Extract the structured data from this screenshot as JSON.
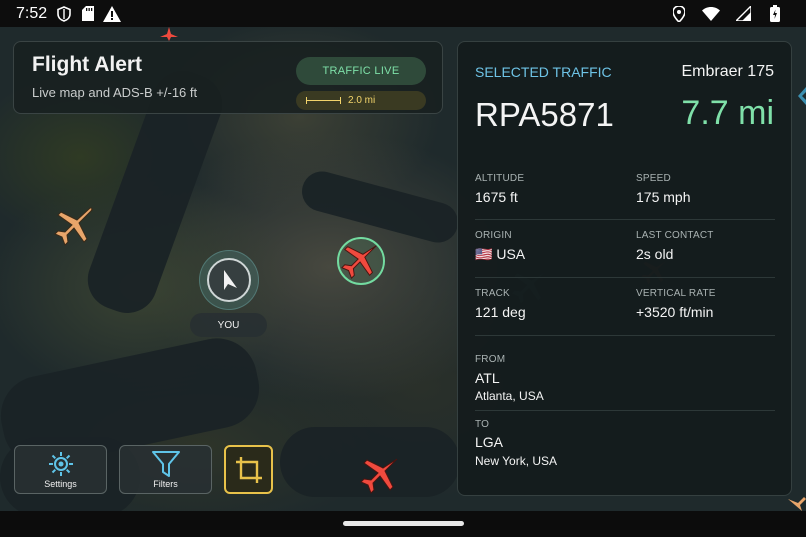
{
  "status_bar": {
    "time": "7:52",
    "left_icons": [
      "shield-icon",
      "sd-card-icon",
      "warning-icon"
    ],
    "right_icons": [
      "location-icon",
      "wifi-icon",
      "signal-icon",
      "battery-icon"
    ]
  },
  "title_card": {
    "title": "Flight Alert",
    "subtitle": "Live map and ADS-B +/-16 ft",
    "traffic_status": "TRAFFIC LIVE",
    "scale_label": "2.0 mi"
  },
  "user_marker": {
    "label": "YOU"
  },
  "detail": {
    "header_label": "SELECTED TRAFFIC",
    "aircraft_type": "Embraer 175",
    "callsign": "RPA5871",
    "distance": "7.7 mi",
    "altitude_label": "ALTITUDE",
    "altitude": "1675 ft",
    "speed_label": "SPEED",
    "speed": "175 mph",
    "origin_label": "ORIGIN",
    "origin": "USA",
    "origin_flag": "🇺🇸",
    "last_contact_label": "LAST CONTACT",
    "last_contact": "2s old",
    "track_label": "TRACK",
    "track": "121 deg",
    "vertical_rate_label": "VERTICAL RATE",
    "vertical_rate": "+3520 ft/min",
    "from_label": "FROM",
    "from_code": "ATL",
    "from_city": "Atlanta, USA",
    "to_label": "TO",
    "to_code": "LGA",
    "to_city": "New York, USA"
  },
  "buttons": {
    "settings": "Settings",
    "filters": "Filters"
  },
  "colors": {
    "accent_green": "#7fe0a9",
    "accent_blue": "#6ec3e6",
    "accent_yellow": "#e8c24a",
    "plane_orange": "#e8a56a",
    "plane_red": "#f04a3e"
  }
}
